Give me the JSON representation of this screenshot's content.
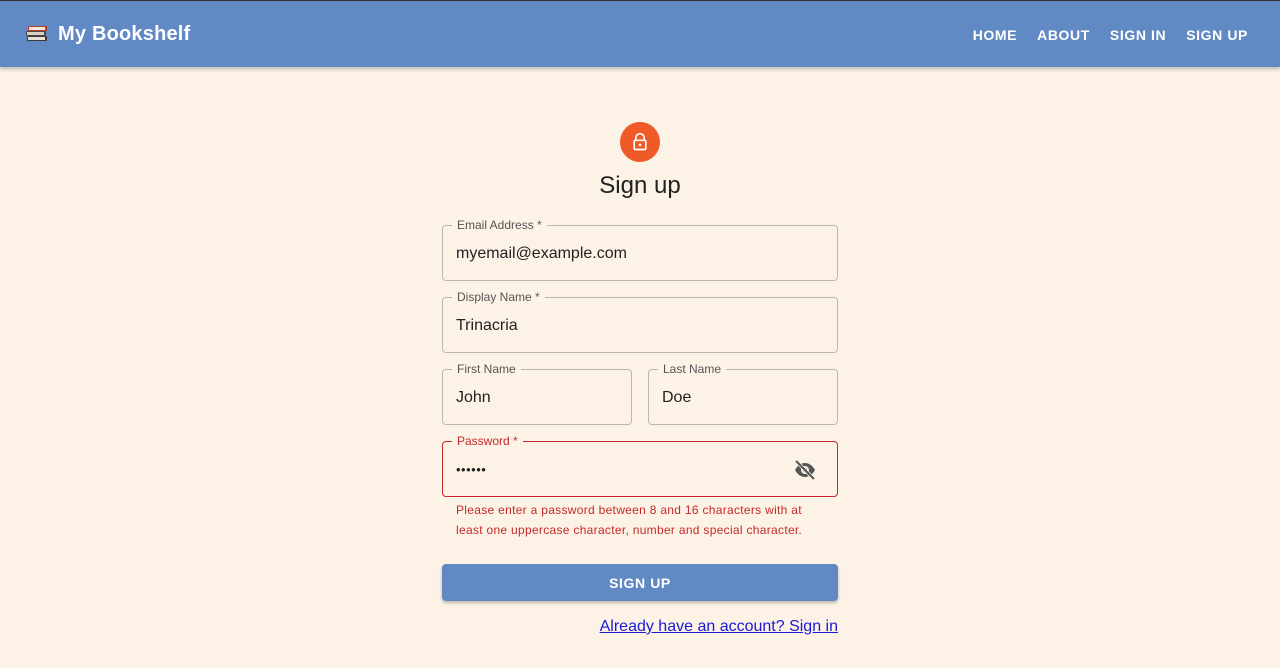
{
  "header": {
    "title": "My Bookshelf",
    "brand_icon": "books-icon",
    "nav": [
      "HOME",
      "ABOUT",
      "SIGN IN",
      "SIGN UP"
    ],
    "background": "#6189c4"
  },
  "form": {
    "title": "Sign up",
    "avatar_icon": "lock-icon",
    "avatar_color": "#f05a28",
    "fields": {
      "email": {
        "label": "Email Address *",
        "value": "myemail@example.com"
      },
      "display_name": {
        "label": "Display Name *",
        "value": "Trinacria"
      },
      "first_name": {
        "label": "First Name",
        "value": "John"
      },
      "last_name": {
        "label": "Last Name",
        "value": "Doe"
      },
      "password": {
        "label": "Password *",
        "value": "••••••",
        "toggle_icon": "visibility-off-icon"
      }
    },
    "password_error": "Please enter a password between 8 and 16 characters with at least one uppercase character, number and special character.",
    "error_color": "#c62828",
    "submit_label": "SIGN UP",
    "signin_link": "Already have an account? Sign in"
  }
}
